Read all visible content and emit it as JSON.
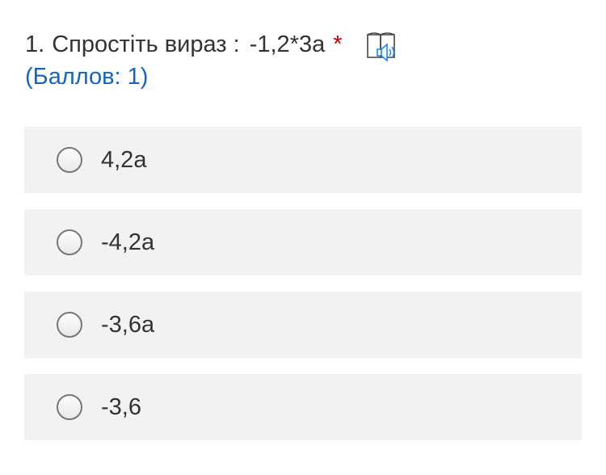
{
  "question": {
    "number": "1.",
    "text": "Спростіть вираз :",
    "expression": "-1,2*3a",
    "required_mark": "*",
    "points": "(Баллов: 1)",
    "audio_icon": "book-audio-icon"
  },
  "options": [
    {
      "label": "4,2a",
      "selected": false
    },
    {
      "label": "-4,2a",
      "selected": false
    },
    {
      "label": "-3,6a",
      "selected": false
    },
    {
      "label": "-3,6",
      "selected": false
    }
  ],
  "colors": {
    "text": "#333333",
    "points": "#1565c0",
    "required": "#cc0000",
    "option_background": "#f2f2f2",
    "icon_accent": "#1e88e5"
  }
}
